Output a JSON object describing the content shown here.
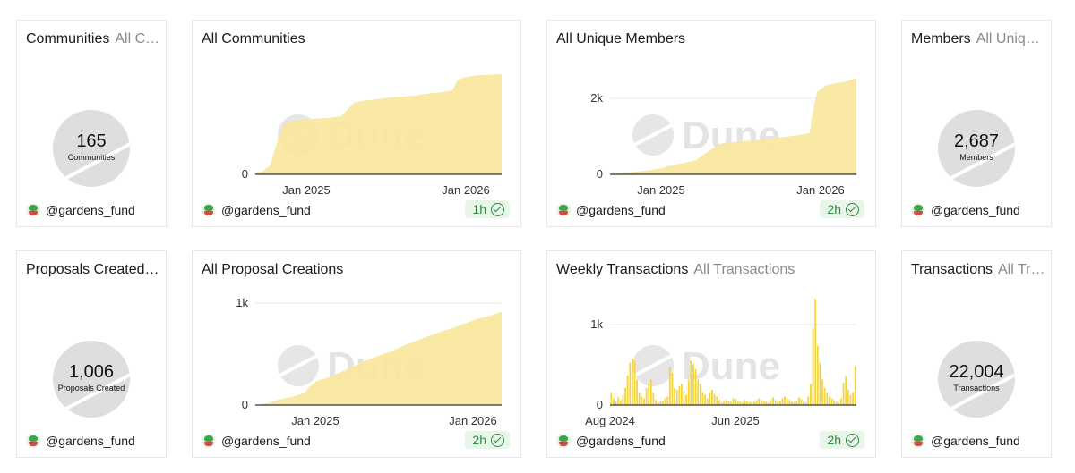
{
  "handle": "@gardens_fund",
  "watermark": "Dune",
  "colors": {
    "fill": "#f9e79a",
    "bar": "#f3d43c",
    "axis": "#333333",
    "counter": "#dedede",
    "badge_bg": "#e8f6e9",
    "badge_fg": "#2d8b3c"
  },
  "icons": {
    "avatar": "garden-avatar-icon",
    "freshness": "check-circle-icon",
    "watermark": "dune-logo-icon"
  },
  "cards": {
    "communities_counter": {
      "title": "Communities",
      "subtitle": "All C…",
      "value": "165",
      "label": "Communities"
    },
    "members_counter": {
      "title": "Members",
      "subtitle": "All Uniq…",
      "value": "2,687",
      "label": "Members"
    },
    "proposals_counter": {
      "title": "Proposals Created…",
      "value": "1,006",
      "label": "Proposals Created"
    },
    "transactions_counter": {
      "title": "Transactions",
      "subtitle": "All Tr…",
      "value": "22,004",
      "label": "Transactions"
    },
    "all_communities": {
      "title": "All Communities",
      "badge": "1h"
    },
    "all_unique_members": {
      "title": "All Unique Members",
      "badge": "2h"
    },
    "all_proposal_creations": {
      "title": "All Proposal Creations",
      "badge": "2h"
    },
    "weekly_transactions": {
      "title": "Weekly Transactions",
      "subtitle": "All Transactions",
      "badge": "2h"
    }
  },
  "chart_data": [
    {
      "type": "area",
      "title": "All Communities",
      "x_ticks": [
        "Jan 2025",
        "Jan 2026"
      ],
      "y_ticks": [
        "0"
      ],
      "ylim": [
        0,
        165
      ],
      "x": [
        0,
        0.03,
        0.06,
        0.09,
        0.12,
        0.16,
        0.2,
        0.25,
        0.3,
        0.35,
        0.4,
        0.45,
        0.5,
        0.55,
        0.6,
        0.65,
        0.7,
        0.75,
        0.8,
        0.82,
        0.85,
        0.9,
        0.95,
        1.0
      ],
      "values": [
        2,
        5,
        15,
        55,
        85,
        88,
        90,
        92,
        93,
        96,
        118,
        122,
        124,
        127,
        128,
        130,
        133,
        135,
        138,
        155,
        160,
        163,
        164,
        165
      ]
    },
    {
      "type": "area",
      "title": "All Unique Members",
      "x_ticks": [
        "Jan 2025",
        "Jan 2026"
      ],
      "y_ticks": [
        "0",
        "2k"
      ],
      "ylim": [
        0,
        2800
      ],
      "x": [
        0,
        0.05,
        0.1,
        0.15,
        0.2,
        0.25,
        0.3,
        0.35,
        0.4,
        0.45,
        0.5,
        0.55,
        0.6,
        0.65,
        0.7,
        0.75,
        0.8,
        0.81,
        0.82,
        0.83,
        0.84,
        0.88,
        0.92,
        0.96,
        1.0
      ],
      "values": [
        20,
        40,
        70,
        110,
        160,
        250,
        320,
        400,
        650,
        860,
        900,
        930,
        960,
        1000,
        1040,
        1080,
        1140,
        1150,
        1600,
        2000,
        2300,
        2500,
        2550,
        2600,
        2687
      ]
    },
    {
      "type": "area",
      "title": "All Proposal Creations",
      "x_ticks": [
        "Jan 2025",
        "Jan 2026"
      ],
      "y_ticks": [
        "0",
        "1k"
      ],
      "ylim": [
        0,
        1100
      ],
      "x": [
        0,
        0.05,
        0.1,
        0.15,
        0.2,
        0.22,
        0.25,
        0.3,
        0.35,
        0.4,
        0.45,
        0.5,
        0.55,
        0.6,
        0.65,
        0.7,
        0.75,
        0.8,
        0.85,
        0.9,
        0.95,
        1.0
      ],
      "values": [
        0,
        20,
        60,
        90,
        130,
        200,
        260,
        300,
        360,
        420,
        480,
        530,
        580,
        640,
        690,
        740,
        790,
        830,
        880,
        930,
        960,
        1006
      ]
    },
    {
      "type": "bar",
      "title": "Weekly Transactions",
      "x_ticks": [
        "Aug 2024",
        "Jun 2025"
      ],
      "y_ticks": [
        "0",
        "1k"
      ],
      "ylim": [
        0,
        1200
      ],
      "values": [
        150,
        80,
        40,
        90,
        60,
        120,
        200,
        350,
        500,
        550,
        520,
        300,
        150,
        100,
        80,
        200,
        250,
        300,
        150,
        60,
        30,
        40,
        50,
        80,
        100,
        450,
        380,
        200,
        180,
        220,
        250,
        160,
        120,
        300,
        520,
        480,
        420,
        300,
        250,
        150,
        120,
        80,
        150,
        180,
        130,
        100,
        60,
        30,
        40,
        60,
        50,
        40,
        80,
        70,
        50,
        40,
        30,
        60,
        50,
        40,
        30,
        40,
        60,
        80,
        60,
        50,
        40,
        30,
        60,
        90,
        60,
        40,
        50,
        80,
        100,
        80,
        60,
        40,
        30,
        50,
        90,
        70,
        40,
        30,
        100,
        250,
        900,
        1250,
        700,
        500,
        300,
        200,
        150,
        100,
        80,
        60,
        40,
        30,
        80,
        260,
        340,
        180,
        120,
        150,
        460
      ]
    }
  ]
}
